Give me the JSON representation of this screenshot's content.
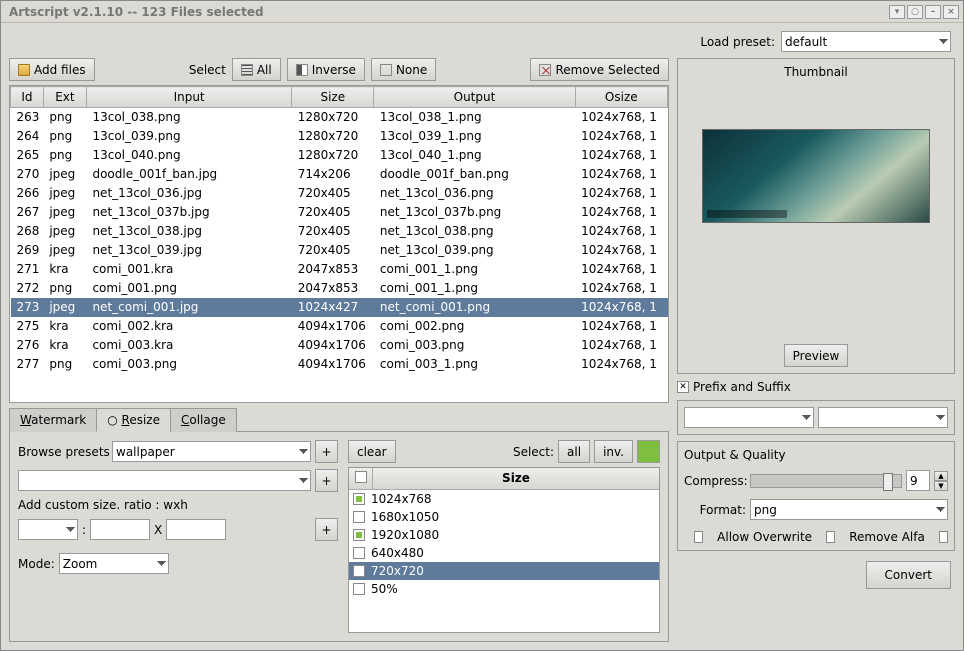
{
  "window": {
    "title": "Artscript v2.1.10 -- 123 Files selected"
  },
  "preset": {
    "label": "Load preset:",
    "value": "default"
  },
  "toolbar": {
    "add_files": "Add files",
    "select_label": "Select",
    "all": "All",
    "inverse": "Inverse",
    "none": "None",
    "remove_selected": "Remove Selected"
  },
  "table": {
    "headers": {
      "id": "Id",
      "ext": "Ext",
      "input": "Input",
      "size": "Size",
      "output": "Output",
      "osize": "Osize"
    },
    "selected_id": 273,
    "rows": [
      {
        "id": 263,
        "ext": "png",
        "input": "13col_038.png",
        "size": "1280x720",
        "output": "13col_038_1.png",
        "osize": "1024x768, 1"
      },
      {
        "id": 264,
        "ext": "png",
        "input": "13col_039.png",
        "size": "1280x720",
        "output": "13col_039_1.png",
        "osize": "1024x768, 1"
      },
      {
        "id": 265,
        "ext": "png",
        "input": "13col_040.png",
        "size": "1280x720",
        "output": "13col_040_1.png",
        "osize": "1024x768, 1"
      },
      {
        "id": 270,
        "ext": "jpeg",
        "input": "doodle_001f_ban.jpg",
        "size": "714x206",
        "output": "doodle_001f_ban.png",
        "osize": "1024x768, 1"
      },
      {
        "id": 266,
        "ext": "jpeg",
        "input": "net_13col_036.jpg",
        "size": "720x405",
        "output": "net_13col_036.png",
        "osize": "1024x768, 1"
      },
      {
        "id": 267,
        "ext": "jpeg",
        "input": "net_13col_037b.jpg",
        "size": "720x405",
        "output": "net_13col_037b.png",
        "osize": "1024x768, 1"
      },
      {
        "id": 268,
        "ext": "jpeg",
        "input": "net_13col_038.jpg",
        "size": "720x405",
        "output": "net_13col_038.png",
        "osize": "1024x768, 1"
      },
      {
        "id": 269,
        "ext": "jpeg",
        "input": "net_13col_039.jpg",
        "size": "720x405",
        "output": "net_13col_039.png",
        "osize": "1024x768, 1"
      },
      {
        "id": 271,
        "ext": "kra",
        "input": "comi_001.kra",
        "size": "2047x853",
        "output": "comi_001_1.png",
        "osize": "1024x768, 1"
      },
      {
        "id": 272,
        "ext": "png",
        "input": "comi_001.png",
        "size": "2047x853",
        "output": "comi_001_1.png",
        "osize": "1024x768, 1"
      },
      {
        "id": 273,
        "ext": "jpeg",
        "input": "net_comi_001.jpg",
        "size": "1024x427",
        "output": "net_comi_001.png",
        "osize": "1024x768, 1"
      },
      {
        "id": 275,
        "ext": "kra",
        "input": "comi_002.kra",
        "size": "4094x1706",
        "output": "comi_002.png",
        "osize": "1024x768, 1"
      },
      {
        "id": 276,
        "ext": "kra",
        "input": "comi_003.kra",
        "size": "4094x1706",
        "output": "comi_003.png",
        "osize": "1024x768, 1"
      },
      {
        "id": 277,
        "ext": "png",
        "input": "comi_003.png",
        "size": "4094x1706",
        "output": "comi_003_1.png",
        "osize": "1024x768, 1"
      }
    ]
  },
  "thumbnail": {
    "title": "Thumbnail",
    "preview_btn": "Preview"
  },
  "tabs": {
    "watermark": "Watermark",
    "resize": "Resize",
    "collage": "Collage",
    "active": "resize"
  },
  "resize": {
    "browse_label": "Browse presets",
    "preset_value": "wallpaper",
    "custom_label": "Add custom size. ratio : wxh",
    "mode_label": "Mode:",
    "mode_value": "Zoom",
    "clear_btn": "clear",
    "select_label": "Select:",
    "all_btn": "all",
    "inv_btn": "inv.",
    "size_header": "Size",
    "sizes": [
      {
        "label": "1024x768",
        "checked": true
      },
      {
        "label": "1680x1050",
        "checked": false
      },
      {
        "label": "1920x1080",
        "checked": true
      },
      {
        "label": "640x480",
        "checked": false
      },
      {
        "label": "720x720",
        "checked": false,
        "selected": true
      },
      {
        "label": "50%",
        "checked": false
      }
    ]
  },
  "prefsuf": {
    "title": "Prefix and Suffix",
    "checked": true
  },
  "outq": {
    "title": "Output & Quality",
    "compress_label": "Compress:",
    "compress_value": "9",
    "compress_pos": 0.88,
    "format_label": "Format:",
    "format_value": "png",
    "allow_overwrite": "Allow Overwrite",
    "remove_alfa": "Remove Alfa"
  },
  "convert_btn": "Convert"
}
